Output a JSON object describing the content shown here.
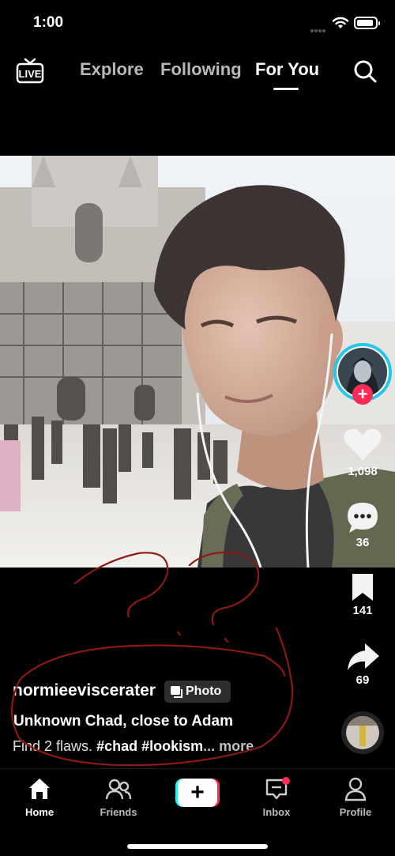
{
  "status_bar": {
    "time": "1:00"
  },
  "top_nav": {
    "live_label": "LIVE",
    "tabs": [
      {
        "label": "Explore",
        "active": false
      },
      {
        "label": "Following",
        "active": false
      },
      {
        "label": "For You",
        "active": true
      }
    ]
  },
  "post": {
    "username": "normieeviscerater",
    "badge_label": "Photo",
    "title": "Unknown Chad, close to Adam",
    "description_text": "Find 2 flaws.",
    "hashtags": [
      "#chad",
      "#lookism"
    ],
    "more_label": "... more"
  },
  "actions": {
    "likes": "1,098",
    "comments": "36",
    "saves": "141",
    "shares": "69"
  },
  "bottom_nav": {
    "items": [
      {
        "label": "Home",
        "icon": "home-icon",
        "active": true
      },
      {
        "label": "Friends",
        "icon": "friends-icon",
        "active": false
      },
      {
        "label": "",
        "icon": "plus-icon",
        "active": false
      },
      {
        "label": "Inbox",
        "icon": "inbox-icon",
        "active": false
      },
      {
        "label": "Profile",
        "icon": "profile-icon",
        "active": false
      }
    ]
  },
  "colors": {
    "accent_pink": "#fe2c55",
    "accent_cyan": "#25f4ee",
    "annotation_red": "#8b1a12"
  }
}
